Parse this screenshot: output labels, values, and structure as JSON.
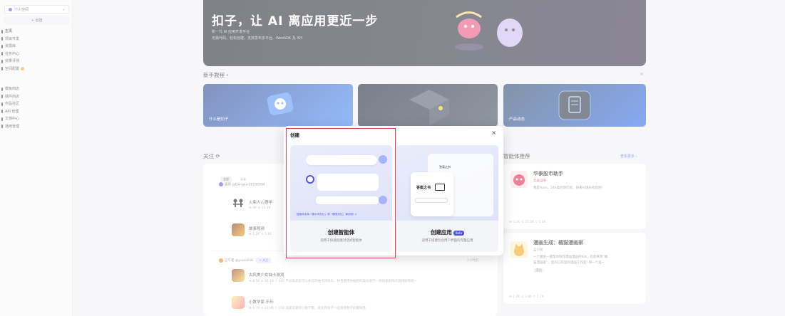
{
  "sidebar": {
    "workspace": "个人空间",
    "create": "+ 创建",
    "items": [
      "主页",
      "项目开发",
      "资源库",
      "任务中心",
      "效果评测",
      "空间配置"
    ],
    "items2": [
      "模板商店",
      "插件商店",
      "作品社区",
      "API 管理",
      "文档中心",
      "通用管理"
    ]
  },
  "hero": {
    "title": "扣子，让 AI 离应用更近一步",
    "sub1": "新一代 AI 应用开发平台",
    "sub2": "无需代码，轻松创建，支持发布多平台、WebSDK 及 API"
  },
  "tutorial": {
    "title": "新手教程 ›",
    "close": "×",
    "cards": [
      "什么是扣子",
      "",
      "产品动态"
    ]
  },
  "follow": {
    "title": "关注 ⟳",
    "filters": [
      "全部",
      "云雀"
    ],
    "user1": "豪哥 @Dangjun20230504",
    "feeds": [
      {
        "title": "火柴人心理学",
        "meta": "⊕ 4K  ⊙ 11.1K"
      },
      {
        "title": "故事视频",
        "meta": "⊕ 1.2K  ⊙ 5.1K"
      }
    ],
    "user2": "言午者 @yuanzhi8",
    "user2_tag": "+ 关注",
    "time2": "2小时前",
    "feeds2": [
      {
        "title": "古风美少女抽卡游戏",
        "meta": "⊕ 8.5K  ⊙ 16.1K  ✩ 145   不必再去担可以体在的抽卡的快乐，并且使用你抽到的美份进行一场快速剧情的游戏剧情吧~"
      },
      {
        "title": "小数学家·乐乐",
        "meta": "⊕ 6.7K  ⊙ 23.9K  ✩ 150   温柔可爱的小数学家，提化和孩子一起感受数学的趣味性。"
      }
    ]
  },
  "recommend": {
    "title": "智能体推荐",
    "more": "查看更多 ›",
    "items": [
      {
        "title": "华泰股市助手",
        "by": "华泰证券",
        "desc": "我是Yomi，24h美时刻盯盘，快来AI涨乐找我吧!",
        "stats": "⊕ 3.2K  ⊙ 15.1K  ✩ 5.6K"
      },
      {
        "title": "漫画生成：橘猫漫画家",
        "by": "孟小龙",
        "desc": "一个模板一键帮你制作漫画漫画的bot。欢迎来到“橘",
        "desc2": "猫漫画家”，您的口袋里的漫画工作室! 每一个美~",
        "tag": "漫画",
        "stats": "⊕ 1.2K  ⊙ 3.8K  ✩ 2.7K"
      }
    ]
  },
  "modal": {
    "title": "创建",
    "close": "×",
    "bubble": "智能体支持「提示词对比」和「模型对比」调试啦! ×",
    "agent_name": "创建智能体",
    "agent_desc": "适用于快速搭建对话式智能体",
    "app_name": "创建应用",
    "app_beta": "Beta",
    "app_desc": "适用于搭建包含用户界面的完整应用",
    "app_card_title": "答案之书",
    "app_card_title2": "答案之书"
  }
}
